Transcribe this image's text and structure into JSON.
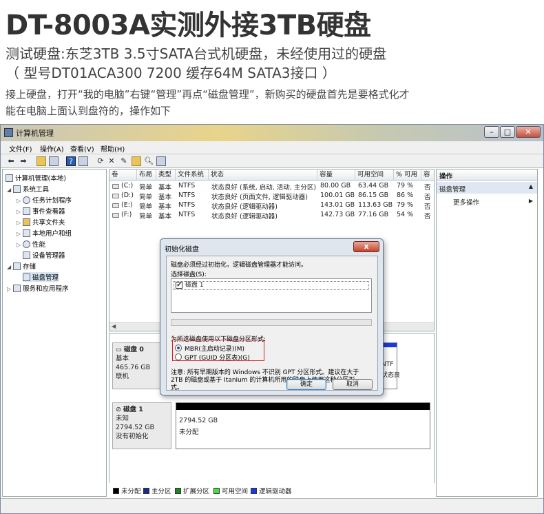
{
  "promo": {
    "headline": "DT-8003A实测外接3TB硬盘",
    "subtitle_line1": "测试硬盘:东芝3TB 3.5寸SATA台式机硬盘，未经使用过的硬盘",
    "subtitle_line2": "（ 型号DT01ACA300 7200 缓存64M SATA3接口 ）",
    "para_line1": "接上硬盘，打开“我的电脑”右键“管理”再点“磁盘管理”，新购买的硬盘首先是要格式化才",
    "para_line2": "能在电脑上面认到盘符的，操作如下"
  },
  "window": {
    "title": "计算机管理",
    "controls": {
      "minimize": "–",
      "maximize": "□",
      "close": "✕"
    },
    "menu": [
      "文件(F)",
      "操作(A)",
      "查看(V)",
      "帮助(H)"
    ]
  },
  "tree": {
    "root": "计算机管理(本地)",
    "system_tools": "系统工具",
    "task_scheduler": "任务计划程序",
    "event_viewer": "事件查看器",
    "shared_folders": "共享文件夹",
    "local_users": "本地用户和组",
    "performance": "性能",
    "device_manager": "设备管理器",
    "storage": "存储",
    "disk_management": "磁盘管理",
    "services": "服务和应用程序"
  },
  "volumes": {
    "headers": [
      "卷",
      "布局",
      "类型",
      "文件系统",
      "状态",
      "容量",
      "可用空间",
      "% 可用",
      "容"
    ],
    "rows": [
      [
        "(C:)",
        "简单",
        "基本",
        "NTFS",
        "状态良好 (系统, 启动, 活动, 主分区)",
        "80.00 GB",
        "63.44 GB",
        "79 %",
        "否"
      ],
      [
        "(D:)",
        "简单",
        "基本",
        "NTFS",
        "状态良好 (页面文件, 逻辑驱动器)",
        "100.01 GB",
        "86.15 GB",
        "86 %",
        "否"
      ],
      [
        "(E:)",
        "简单",
        "基本",
        "NTFS",
        "状态良好 (逻辑驱动器)",
        "143.01 GB",
        "113.63 GB",
        "79 %",
        "否"
      ],
      [
        "(F:)",
        "简单",
        "基本",
        "NTFS",
        "状态良好 (逻辑驱动器)",
        "142.73 GB",
        "77.16 GB",
        "54 %",
        "否"
      ]
    ]
  },
  "disks": {
    "disk0": {
      "name": "磁盘 0",
      "type": "基本",
      "size": "465.76 GB",
      "status": "联机",
      "partition_fs": "NTF",
      "partition_status": "状态良"
    },
    "disk1": {
      "name": "磁盘 1",
      "type": "未知",
      "size": "2794.52 GB",
      "status": "没有初始化",
      "region_size": "2794.52 GB",
      "region_status": "未分配"
    }
  },
  "legend": [
    {
      "label": "未分配",
      "color": "#000000"
    },
    {
      "label": "主分区",
      "color": "#1a2a8a"
    },
    {
      "label": "扩展分区",
      "color": "#1a8a1a"
    },
    {
      "label": "可用空间",
      "color": "#44dd44"
    },
    {
      "label": "逻辑驱动器",
      "color": "#1a3adf"
    }
  ],
  "actions": {
    "header": "操作",
    "section": "磁盘管理",
    "more": "更多操作"
  },
  "dialog": {
    "title": "初始化磁盘",
    "message": "磁盘必须经过初始化，逻辑磁盘管理器才能访问。",
    "select_label": "选择磁盘(S):",
    "disk_item": "磁盘 1",
    "partition_label": "为所选磁盘使用以下磁盘分区形式:",
    "option_mbr": "MBR(主启动记录)(M)",
    "option_gpt": "GPT (GUID 分区表)(G)",
    "note_line1": "注意: 所有早期版本的 Windows 不识别 GPT 分区形式。建议在大于",
    "note_line2": "2TB 的磁盘或基于 Itanium 的计算机所用的磁盘上使用这种分区形",
    "note_line3": "式。",
    "ok": "确定",
    "cancel": "取消",
    "close_glyph": "x"
  }
}
